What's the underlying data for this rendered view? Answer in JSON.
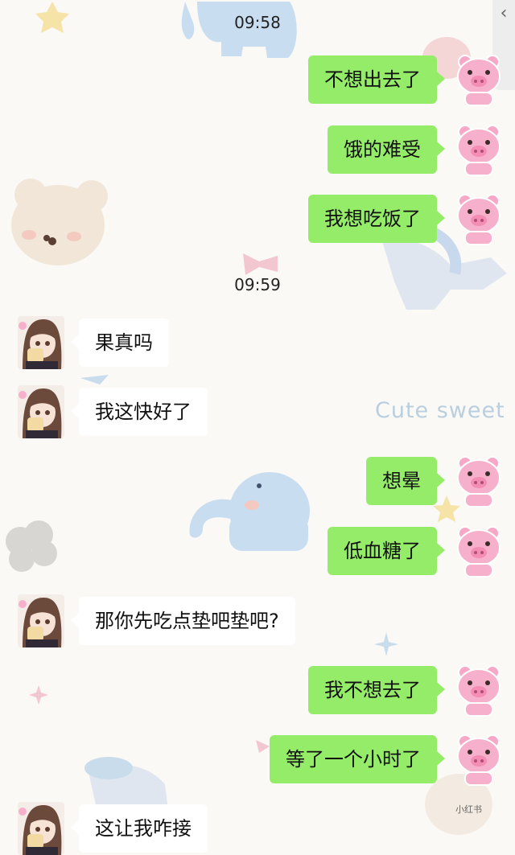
{
  "watermark_text": "Cute sweet",
  "credit_text": "小红书",
  "back_icon": "chevron-left-icon",
  "timestamps": [
    "09:58",
    "09:59"
  ],
  "messages": [
    {
      "side": "out",
      "text": "不想出去了"
    },
    {
      "side": "out",
      "text": "饿的难受"
    },
    {
      "side": "out",
      "text": "我想吃饭了"
    },
    {
      "side": "in",
      "text": "果真吗"
    },
    {
      "side": "in",
      "text": "我这快好了"
    },
    {
      "side": "out",
      "text": "想晕"
    },
    {
      "side": "out",
      "text": "低血糖了"
    },
    {
      "side": "in",
      "text": "那你先吃点垫吧垫吧?"
    },
    {
      "side": "out",
      "text": "我不想去了"
    },
    {
      "side": "out",
      "text": "等了一个小时了"
    },
    {
      "side": "in",
      "text": "这让我咋接"
    }
  ],
  "colors": {
    "outgoing_bubble": "#95ec69",
    "incoming_bubble": "#ffffff",
    "background": "#faf9f6"
  }
}
